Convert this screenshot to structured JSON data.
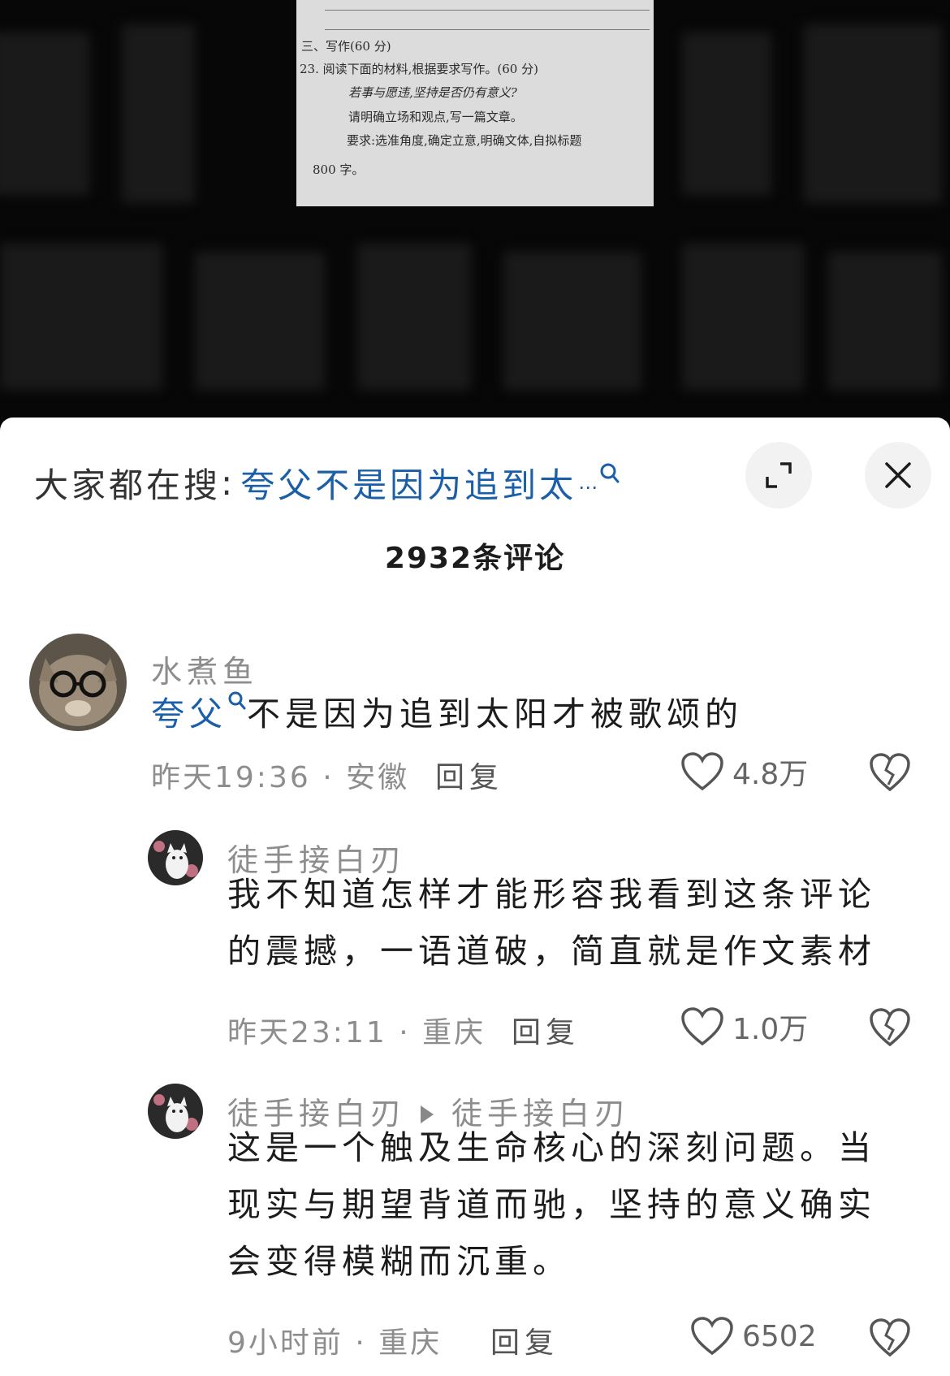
{
  "exam_paper": {
    "section_title": "三、写作(60 分)",
    "question": "23. 阅读下面的材料,根据要求写作。(60 分)",
    "prompt": "若事与愿违,坚持是否仍有意义?",
    "instruction": "请明确立场和观点,写一篇文章。",
    "requirements": "要求:选准角度,确定立意,明确文体,自拟标题",
    "word_count": "800 字。"
  },
  "header": {
    "search_prefix": "大家都在搜",
    "search_colon": ":",
    "search_term": "夸父不是因为追到太",
    "search_ellipsis": "…",
    "comment_count": "2932条评论"
  },
  "comments": [
    {
      "username": "水煮鱼",
      "text_link": "夸父",
      "text_rest": "不是因为追到太阳才被歌颂的",
      "time_location": "昨天19:36 · 安徽",
      "reply_label": "回复",
      "likes": "4.8万"
    },
    {
      "username": "徒手接白刃",
      "text_lines": [
        "我不知道怎样才能形容我看到这条评论",
        "的震撼，一语道破，简直就是作文素材"
      ],
      "time_location": "昨天23:11 · 重庆",
      "reply_label": "回复",
      "likes": "1.0万"
    },
    {
      "username": "徒手接白刃",
      "reply_to": "徒手接白刃",
      "text_lines": [
        "这是一个触及生命核心的深刻问题。当",
        "现实与期望背道而驰，坚持的意义确实",
        "会变得模糊而沉重。"
      ],
      "time_location": "9小时前 · 重庆",
      "reply_label": "回复",
      "likes": "6502"
    }
  ],
  "colors": {
    "link": "#1a5fa8",
    "text": "#1c1c1c",
    "muted": "#8d8d8d",
    "button_bg": "#f2f2f2"
  },
  "icons": [
    "search-icon",
    "expand-icon",
    "close-icon",
    "heart-icon",
    "broken-heart-icon"
  ]
}
